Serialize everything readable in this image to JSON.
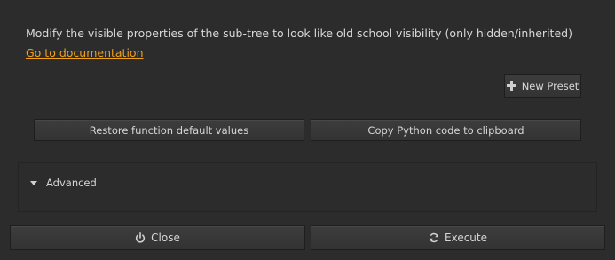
{
  "description": "Modify the visible properties of the sub-tree to look like old school visibility (only hidden/inherited)",
  "doc_link": "Go to documentation",
  "preset": {
    "label": "New Preset",
    "icon": "plus-icon"
  },
  "actions": {
    "restore_label": "Restore function default values",
    "copy_label": "Copy Python code to clipboard"
  },
  "advanced": {
    "label": "Advanced",
    "expanded": false
  },
  "footer": {
    "close_label": "Close",
    "close_icon": "power-icon",
    "execute_label": "Execute",
    "execute_icon": "refresh-icon"
  },
  "colors": {
    "background": "#2c2c2c",
    "link": "#f0a21b",
    "text": "#d6d6d6"
  }
}
